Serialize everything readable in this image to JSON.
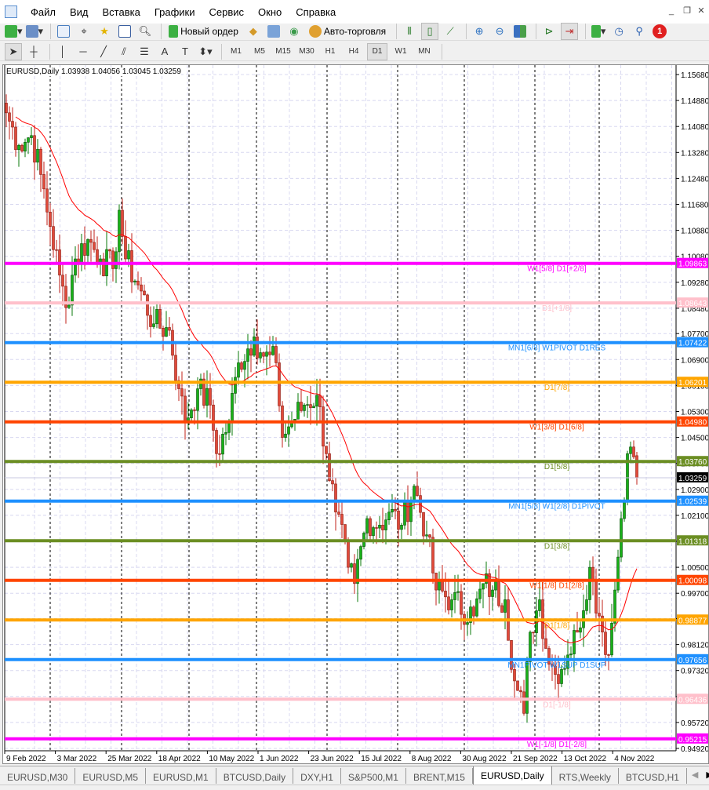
{
  "menu": [
    "Файл",
    "Вид",
    "Вставка",
    "Графики",
    "Сервис",
    "Окно",
    "Справка"
  ],
  "toolbar": {
    "new_order": "Новый ордер",
    "autotrading": "Авто-торговля",
    "notifications": "1"
  },
  "timeframes": [
    "M1",
    "M5",
    "M15",
    "M30",
    "H1",
    "H4",
    "D1",
    "W1",
    "MN"
  ],
  "active_timeframe": "D1",
  "chart_title": "EURUSD,Daily  1.03938 1.04056 1.03045 1.03259",
  "chart_data": {
    "type": "candlestick",
    "symbol": "EURUSD",
    "period": "Daily",
    "last_bar": {
      "open": 1.03938,
      "high": 1.04056,
      "low": 1.03045,
      "close": 1.03259
    },
    "current_price": "1.03259",
    "ylim": [
      0.9478,
      1.158
    ],
    "yticks": [
      "1.15680",
      "1.14880",
      "1.14080",
      "1.13280",
      "1.12480",
      "1.11680",
      "1.10880",
      "1.10080",
      "1.09280",
      "1.08480",
      "1.07700",
      "1.06900",
      "1.06100",
      "1.05300",
      "1.04500",
      "1.03700",
      "1.02900",
      "1.02100",
      "1.01300",
      "1.00500",
      "0.99700",
      "0.98920",
      "0.98120",
      "0.97320",
      "0.96520",
      "0.95720",
      "0.94920"
    ],
    "xticks": [
      "9 Feb 2022",
      "3 Mar 2022",
      "25 Mar 2022",
      "18 Apr 2022",
      "10 May 2022",
      "1 Jun 2022",
      "23 Jun 2022",
      "15 Jul 2022",
      "8 Aug 2022",
      "30 Aug 2022",
      "21 Sep 2022",
      "13 Oct 2022",
      "4 Nov 2022"
    ],
    "bar_count": 202,
    "close_anchors": [
      [
        0,
        1.145
      ],
      [
        4,
        1.135
      ],
      [
        8,
        1.138
      ],
      [
        11,
        1.126
      ],
      [
        14,
        1.11
      ],
      [
        17,
        1.095
      ],
      [
        19,
        1.085
      ],
      [
        22,
        1.1
      ],
      [
        26,
        1.106
      ],
      [
        30,
        1.1
      ],
      [
        34,
        1.097
      ],
      [
        36,
        1.115
      ],
      [
        38,
        1.1
      ],
      [
        42,
        1.092
      ],
      [
        47,
        1.08
      ],
      [
        52,
        1.078
      ],
      [
        55,
        1.06
      ],
      [
        57,
        1.05
      ],
      [
        61,
        1.06
      ],
      [
        65,
        1.055
      ],
      [
        67,
        1.04
      ],
      [
        71,
        1.05
      ],
      [
        74,
        1.068
      ],
      [
        79,
        1.076
      ],
      [
        82,
        1.07
      ],
      [
        86,
        1.068
      ],
      [
        88,
        1.045
      ],
      [
        91,
        1.05
      ],
      [
        95,
        1.055
      ],
      [
        99,
        1.058
      ],
      [
        102,
        1.04
      ],
      [
        105,
        1.022
      ],
      [
        109,
        1.005
      ],
      [
        111,
        1.0
      ],
      [
        115,
        1.02
      ],
      [
        119,
        1.018
      ],
      [
        122,
        1.022
      ],
      [
        126,
        1.018
      ],
      [
        130,
        1.03
      ],
      [
        134,
        1.015
      ],
      [
        137,
        0.998
      ],
      [
        142,
        0.995
      ],
      [
        149,
        0.99
      ],
      [
        152,
        1.0
      ],
      [
        155,
        0.998
      ],
      [
        159,
        0.995
      ],
      [
        162,
        0.97
      ],
      [
        165,
        0.96
      ],
      [
        167,
        0.985
      ],
      [
        170,
        0.995
      ],
      [
        172,
        0.98
      ],
      [
        175,
        0.972
      ],
      [
        179,
        0.978
      ],
      [
        182,
        0.985
      ],
      [
        186,
        1.005
      ],
      [
        189,
        0.99
      ],
      [
        192,
        0.978
      ],
      [
        194,
        0.998
      ],
      [
        196,
        1.02
      ],
      [
        198,
        1.04
      ],
      [
        200,
        1.039
      ],
      [
        201,
        1.03259
      ]
    ],
    "moving_average": {
      "type": "smoothed",
      "color": "#ff0000"
    },
    "levels": [
      {
        "price": 1.09863,
        "value": "1.09863",
        "label": "W1[5/8] D1[+2/8]",
        "color": "#ff00ff"
      },
      {
        "price": 1.08643,
        "value": "1.08643",
        "label": "D1[+1/8]",
        "color": "#ffc0cb"
      },
      {
        "price": 1.07422,
        "value": "1.07422",
        "label": "MN1[6/8] W1PIVOT D1RES",
        "color": "#1e90ff"
      },
      {
        "price": 1.06201,
        "value": "1.06201",
        "label": "D1[7/8]",
        "color": "#ffa500"
      },
      {
        "price": 1.0498,
        "value": "1.04980",
        "label": "W1[3/8] D1[6/8]",
        "color": "#ff4500"
      },
      {
        "price": 1.0376,
        "value": "1.03760",
        "label": "D1[5/8]",
        "color": "#6b8e23"
      },
      {
        "price": 1.02539,
        "value": "1.02539",
        "label": "MN1[5/8] W1[2/8] D1PIVOT",
        "color": "#1e90ff"
      },
      {
        "price": 1.01318,
        "value": "1.01318",
        "label": "D1[3/8]",
        "color": "#6b8e23"
      },
      {
        "price": 1.00098,
        "value": "1.00098",
        "label": "W1[1/8] D1[2/8]",
        "color": "#ff4500"
      },
      {
        "price": 0.98877,
        "value": "0.98877",
        "label": "D1[1/8]",
        "color": "#ffa500"
      },
      {
        "price": 0.97656,
        "value": "0.97656",
        "label": "MN1PIVOT W1SUP D1SUP",
        "color": "#1e90ff"
      },
      {
        "price": 0.96436,
        "value": "0.96436",
        "label": "D1[-1/8]",
        "color": "#ffc0cb"
      },
      {
        "price": 0.95215,
        "value": "0.95215",
        "label": "W1[-1/8] D1[-2/8]",
        "color": "#ff00ff"
      }
    ]
  },
  "tabs": [
    "EURUSD,M30",
    "EURUSD,M5",
    "EURUSD,M1",
    "BTCUSD,Daily",
    "DXY,H1",
    "S&P500,M1",
    "BRENT,M15",
    "EURUSD,Daily",
    "RTS,Weekly",
    "BTCUSD,H1"
  ],
  "active_tab": "EURUSD,Daily"
}
